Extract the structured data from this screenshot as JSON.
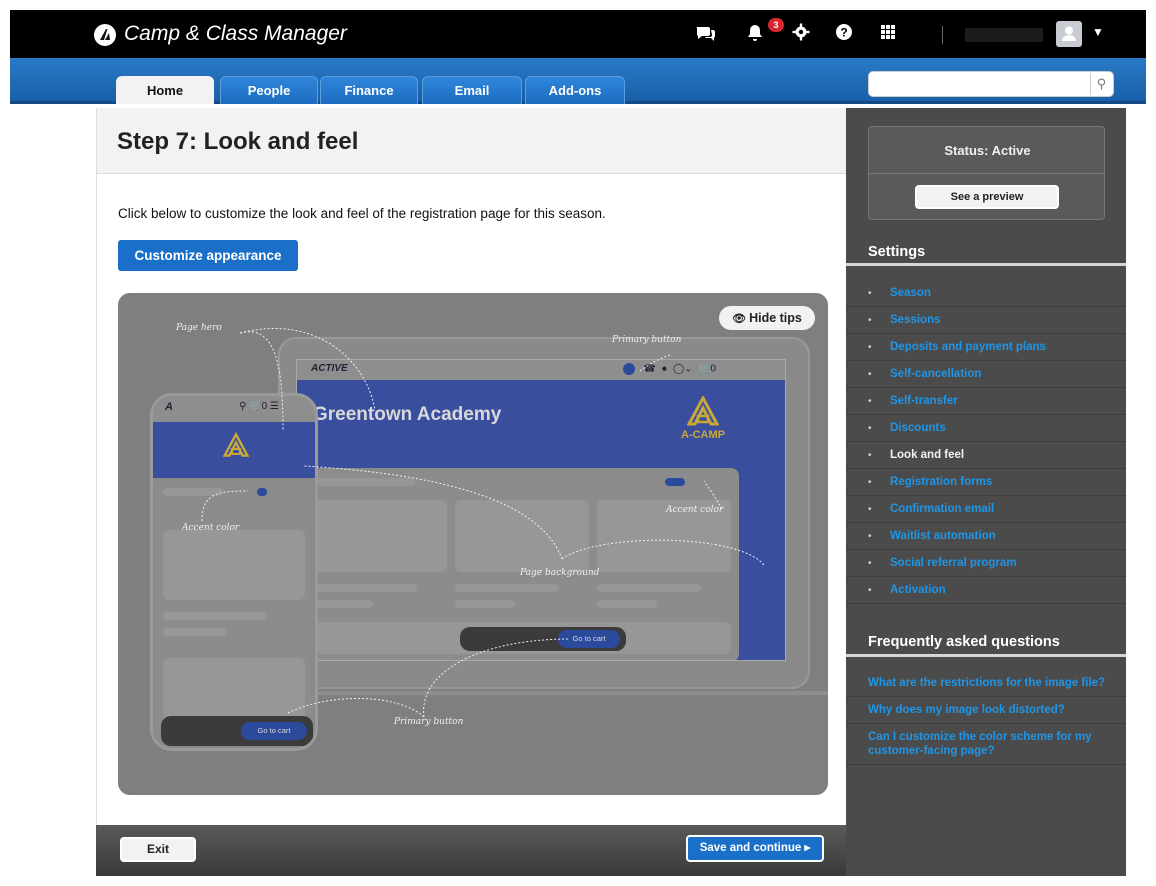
{
  "app": {
    "title": "Camp & Class Manager",
    "notification_count": "3"
  },
  "top_icons": [
    "chat-icon",
    "bell-icon",
    "gear-icon",
    "help-icon",
    "apps-grid-icon"
  ],
  "nav": {
    "tabs": [
      {
        "label": "Home",
        "active": true
      },
      {
        "label": "People",
        "active": false
      },
      {
        "label": "Finance",
        "active": false
      },
      {
        "label": "Email",
        "active": false
      },
      {
        "label": "Add-ons",
        "active": false
      }
    ],
    "search_placeholder": ""
  },
  "main": {
    "title": "Step 7: Look and feel",
    "intro": "Click below to customize the look and feel of the registration page for this season.",
    "customize_button": "Customize appearance",
    "illustration": {
      "hide_tips": "Hide tips",
      "brand": "ACTIVE",
      "hero_title": "Greentown Academy",
      "logo_text": "A-CAMP",
      "cart_count": "0",
      "go_to_cart": "Go to cart",
      "annotations": {
        "page_hero": "Page hero",
        "primary_button_top": "Primary button",
        "accent_color_left": "Accent color",
        "accent_color_right": "Accent color",
        "page_background": "Page background",
        "primary_button_bottom": "Primary button"
      }
    }
  },
  "footer": {
    "exit": "Exit",
    "save": "Save and continue ▸"
  },
  "sidebar": {
    "status": "Status: Active",
    "preview_button": "See a preview",
    "settings_heading": "Settings",
    "settings": [
      {
        "label": "Season",
        "current": false
      },
      {
        "label": "Sessions",
        "current": false
      },
      {
        "label": "Deposits and payment plans",
        "current": false
      },
      {
        "label": "Self-cancellation",
        "current": false
      },
      {
        "label": "Self-transfer",
        "current": false
      },
      {
        "label": "Discounts",
        "current": false
      },
      {
        "label": "Look and feel",
        "current": true
      },
      {
        "label": "Registration forms",
        "current": false
      },
      {
        "label": "Confirmation email",
        "current": false
      },
      {
        "label": "Waitlist automation",
        "current": false
      },
      {
        "label": "Social referral program",
        "current": false
      },
      {
        "label": "Activation",
        "current": false
      }
    ],
    "faq_heading": "Frequently asked questions",
    "faq": [
      "What are the restrictions for the image file?",
      "Why does my image look distorted?",
      "Can I customize the color scheme for my customer-facing page?"
    ]
  },
  "colors": {
    "brand_blue": "#1a6fc9",
    "link_blue": "#1e96e8",
    "sidebar_bg": "#4b4b4b",
    "badge_red": "#d6262f"
  }
}
